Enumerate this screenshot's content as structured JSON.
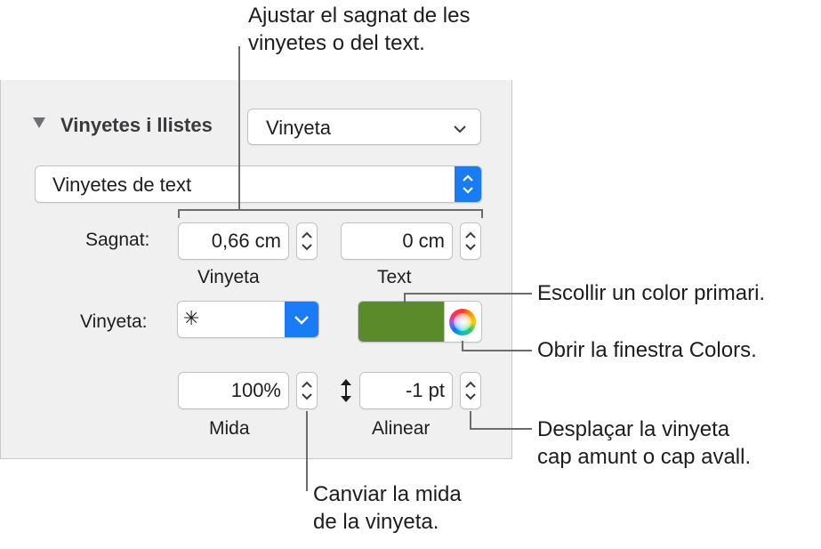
{
  "section": {
    "title": "Vinyetes i llistes",
    "list_style_value": "Vinyeta",
    "bullet_type_value": "Vinyetes de text"
  },
  "indent": {
    "label": "Sagnat:",
    "bullet_value": "0,66 cm",
    "bullet_caption": "Vinyeta",
    "text_value": "0 cm",
    "text_caption": "Text"
  },
  "bullet": {
    "label": "Vinyeta:",
    "symbol": "✳",
    "color_well_hex": "#5a8a2a"
  },
  "size_align": {
    "size_value": "100%",
    "size_caption": "Mida",
    "align_value": "-1 pt",
    "align_caption": "Alinear"
  },
  "callouts": {
    "indent_line1": "Ajustar el sagnat de les",
    "indent_line2": "vinyetes o del text.",
    "color_primary": "Escollir un color primari.",
    "colors_window": "Obrir la finestra Colors.",
    "move_line1": "Desplaçar la vinyeta",
    "move_line2": "cap amunt o cap avall.",
    "size_line1": "Canviar la mida",
    "size_line2": "de la vinyeta."
  },
  "colors": {
    "panel_bg": "#f0f0f0",
    "accent_blue": "#1a7cf5",
    "bullet_green": "#5a8a2a"
  }
}
